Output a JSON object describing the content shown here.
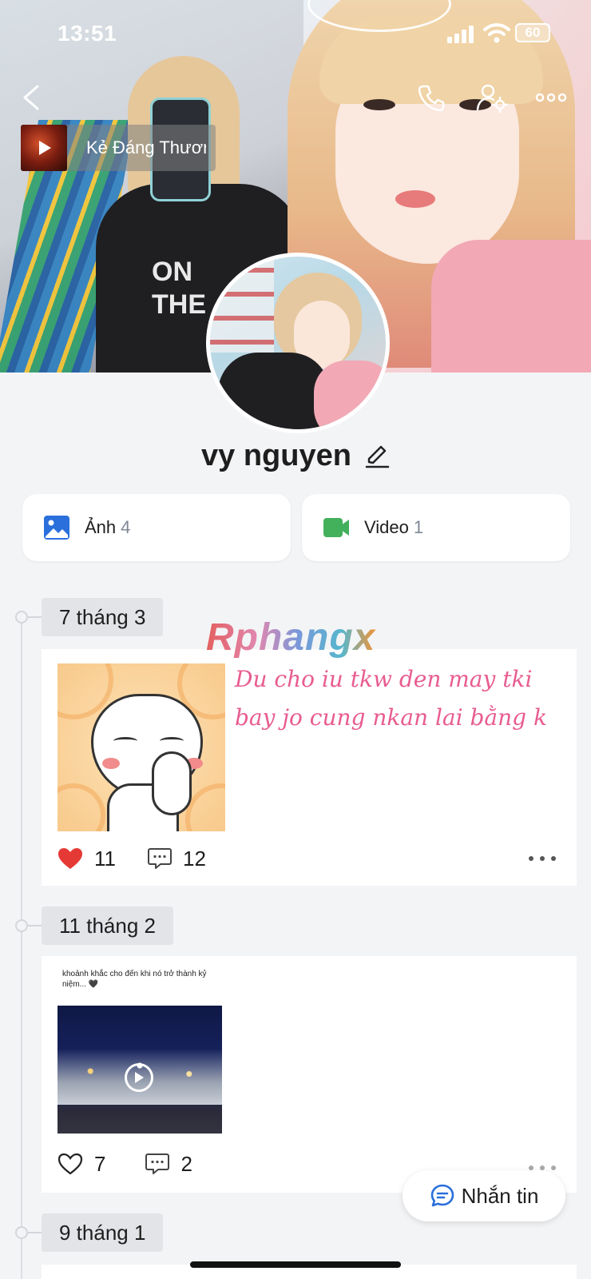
{
  "status_bar": {
    "time": "13:51",
    "battery": "60"
  },
  "music": {
    "title": "Kẻ Đáng Thương"
  },
  "profile": {
    "name": "vy nguyen"
  },
  "media": {
    "photos_label": "Ảnh",
    "photos_count": "4",
    "videos_label": "Video",
    "videos_count": "1"
  },
  "watermark": "Rphangx",
  "posts": [
    {
      "date": "7 tháng 3",
      "text": "Du cho iu tkw den may tki bay jo cung nkan lai bằng k",
      "likes": "11",
      "comments": "12",
      "liked": true
    },
    {
      "date": "11 tháng 2",
      "caption": "khoảnh khắc cho đến khi nó trở thành kỷ niệm... 🖤",
      "likes": "7",
      "comments": "2",
      "liked": false
    },
    {
      "date": "9 tháng 1"
    }
  ],
  "message_button": {
    "label": "Nhắn tin"
  },
  "colors": {
    "heart": "#e53935",
    "accent": "#2a6fdb",
    "video_icon": "#43b05c",
    "post_text": "#e85c90"
  }
}
